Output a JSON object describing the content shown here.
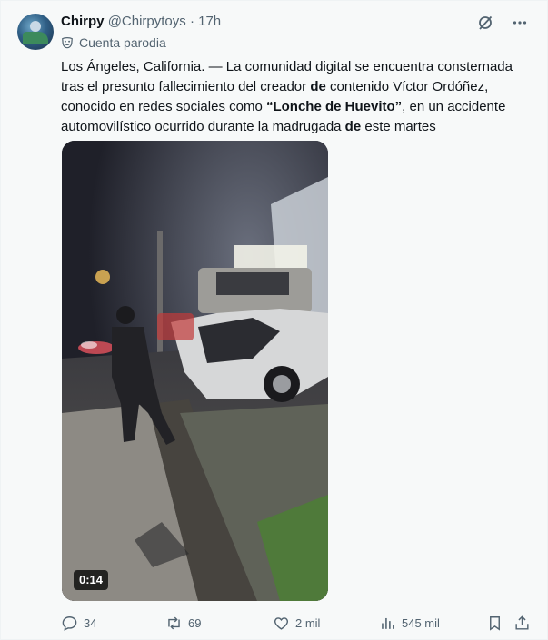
{
  "post": {
    "author_name": "Chirpy",
    "author_handle": "@Chirpytoys",
    "separator": "·",
    "time": "17h",
    "badge_label": "Cuenta parodia",
    "text_parts": [
      "Los Ángeles, California. — La comunidad digital se encuentra consternada tras el presunto fallecimiento del creador ",
      "de",
      " contenido Víctor Ordóñez, conocido en redes sociales como ",
      "“Lonche de Huevito”",
      ", en un accidente automovilístico ocurrido durante la madrugada ",
      "de",
      " este martes"
    ],
    "video_duration": "0:14"
  },
  "actions": {
    "replies": "34",
    "reposts": "69",
    "likes": "2 mil",
    "views": "545 mil"
  },
  "icons": {
    "avatar": "avatar-image",
    "badge": "parody-mask-icon",
    "grok": "grok-icon",
    "more": "more-icon",
    "reply": "reply-icon",
    "repost": "repost-icon",
    "like": "like-icon",
    "views": "views-icon",
    "bookmark": "bookmark-icon",
    "share": "share-icon"
  },
  "colors": {
    "background": "#f7f9f9",
    "text": "#0f1419",
    "muted": "#536471"
  }
}
